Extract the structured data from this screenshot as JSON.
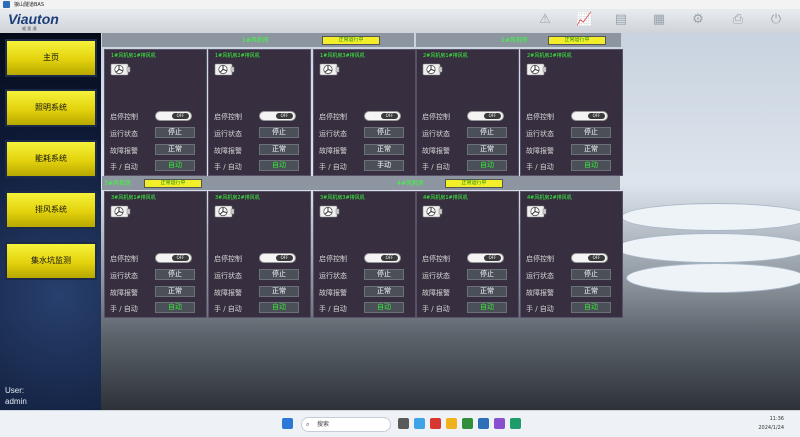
{
  "window": {
    "title": "狼山隧道BAS"
  },
  "header": {
    "logo": "Viauton",
    "logo_sub": "威 奥 通",
    "toolbar": [
      {
        "name": "warning-icon",
        "glyph": "⚠"
      },
      {
        "name": "trend-chart-icon",
        "glyph": "📈"
      },
      {
        "name": "report-icon",
        "glyph": "▤"
      },
      {
        "name": "document-icon",
        "glyph": "▦"
      },
      {
        "name": "settings-icon",
        "glyph": "⚙"
      },
      {
        "name": "printer-icon",
        "glyph": "⎙"
      },
      {
        "name": "power-icon",
        "glyph": "⏻"
      }
    ]
  },
  "nav": {
    "items": [
      "主页",
      "照明系统",
      "能耗系统",
      "排风系统",
      "集水坑监测"
    ],
    "user_label": "User:",
    "user_name": "admin"
  },
  "groups": [
    {
      "label": "1#风机房",
      "status": "正常运行中"
    },
    {
      "label": "2#风机房",
      "status": "正常运行中"
    },
    {
      "label": "3#风机房",
      "status": "正常运行中"
    },
    {
      "label": "4#风机房",
      "status": "正常运行中"
    }
  ],
  "labels": {
    "control": "启停控制",
    "run_state": "运行状态",
    "fault": "故障报警",
    "mode": "手 / 自动",
    "toggle": "OFF"
  },
  "fans": [
    {
      "title": "1#风机房1#排风机",
      "state": "停止",
      "fault": "正常",
      "mode": "自动"
    },
    {
      "title": "1#风机房2#排风机",
      "state": "停止",
      "fault": "正常",
      "mode": "自动"
    },
    {
      "title": "1#风机房3#排风机",
      "state": "停止",
      "fault": "正常",
      "mode": "手动"
    },
    {
      "title": "2#风机房1#排风机",
      "state": "停止",
      "fault": "正常",
      "mode": "自动"
    },
    {
      "title": "2#风机房2#排风机",
      "state": "停止",
      "fault": "正常",
      "mode": "自动"
    },
    {
      "title": "3#风机房1#排风机",
      "state": "停止",
      "fault": "正常",
      "mode": "自动"
    },
    {
      "title": "3#风机房2#排风机",
      "state": "停止",
      "fault": "正常",
      "mode": "自动"
    },
    {
      "title": "3#风机房3#排风机",
      "state": "停止",
      "fault": "正常",
      "mode": "自动"
    },
    {
      "title": "4#风机房1#排风机",
      "state": "停止",
      "fault": "正常",
      "mode": "自动"
    },
    {
      "title": "4#风机房2#排风机",
      "state": "停止",
      "fault": "正常",
      "mode": "自动"
    }
  ],
  "taskbar": {
    "search_placeholder": "搜索",
    "time": "11:36",
    "date": "2024/1/24"
  }
}
